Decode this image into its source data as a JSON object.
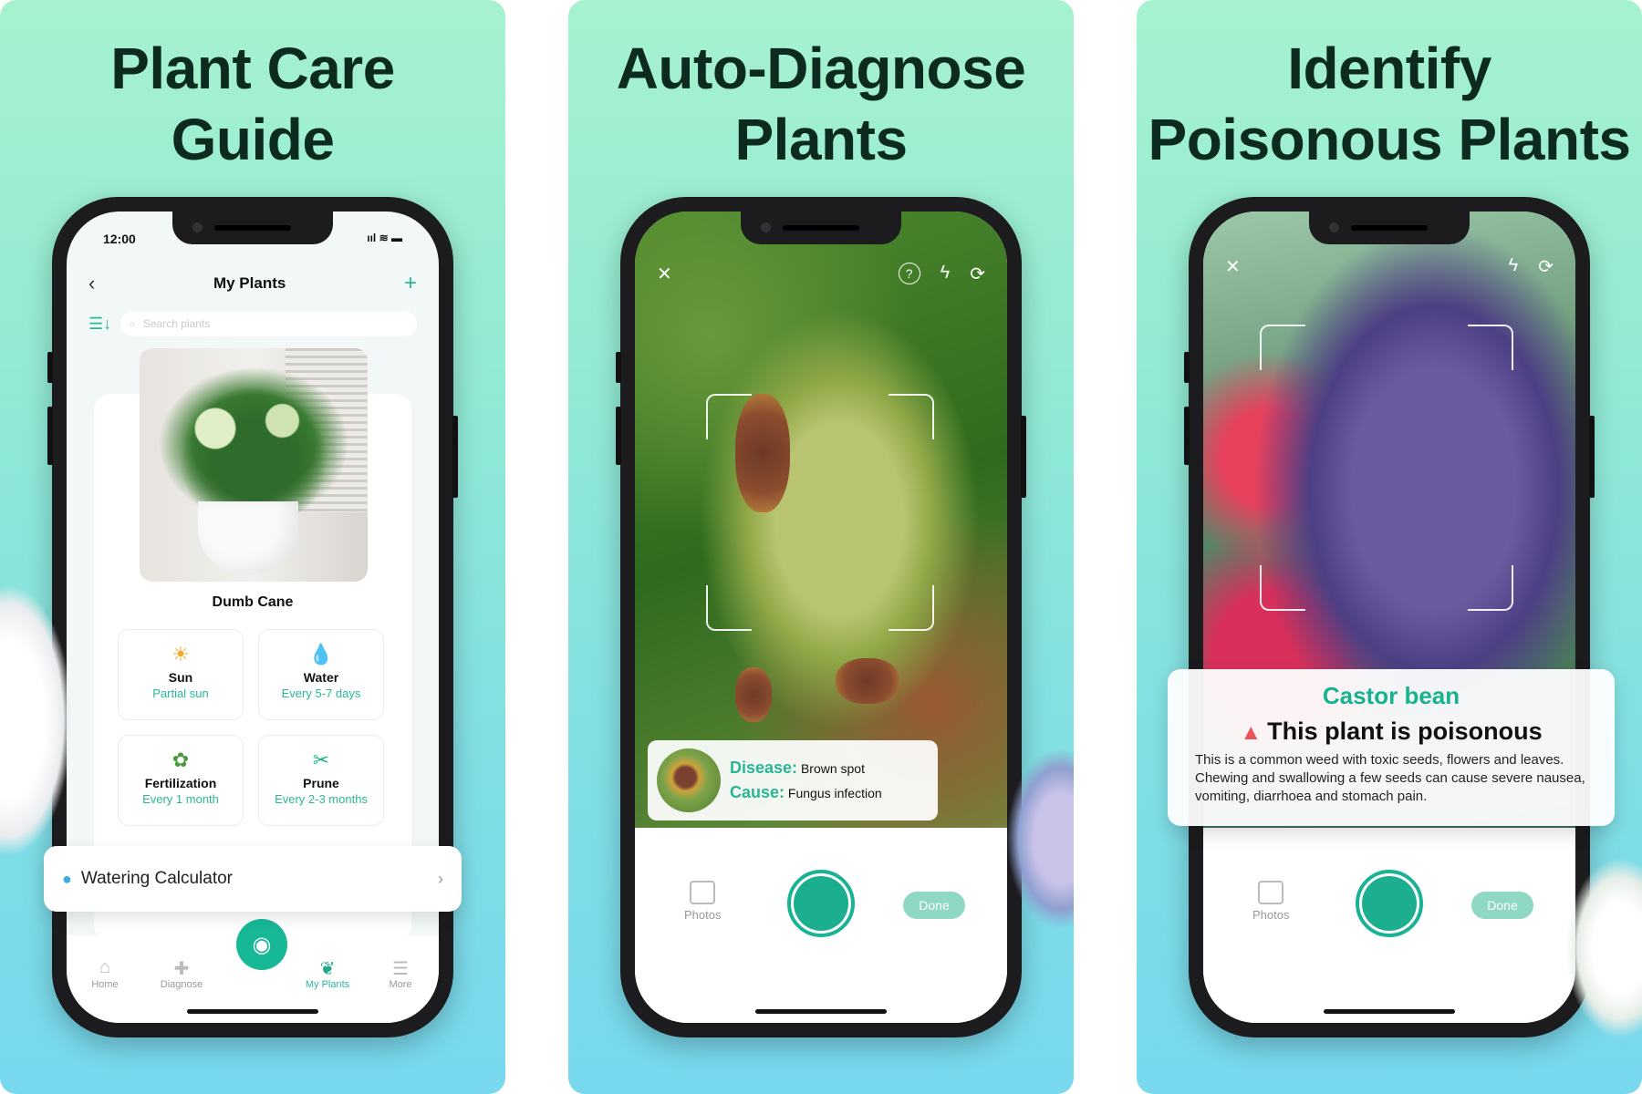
{
  "panels": [
    {
      "headline_line1": "Plant Care",
      "headline_line2": "Guide",
      "status_time": "12:00",
      "status_icons": "ııl ≋ ▬",
      "nav": {
        "back_icon": "‹",
        "title": "My Plants",
        "add_icon": "+"
      },
      "search": {
        "sort_icon": "☰↓",
        "search_icon": "⌕",
        "placeholder": "Search plants"
      },
      "plant_name": "Dumb Cane",
      "care_tiles": [
        {
          "icon": "☀",
          "icon_name": "sun-icon",
          "title": "Sun",
          "value": "Partial sun",
          "icon_color": "#f5a623"
        },
        {
          "icon": "💧",
          "icon_name": "water-drop-icon",
          "title": "Water",
          "value": "Every 5-7 days",
          "icon_color": "#3aa8e0"
        },
        {
          "icon": "✿",
          "icon_name": "fertilizer-icon",
          "title": "Fertilization",
          "value": "Every 1 month",
          "icon_color": "#4a9a3a"
        },
        {
          "icon": "✂",
          "icon_name": "scissors-icon",
          "title": "Prune",
          "value": "Every 2-3 months",
          "icon_color": "#1fb08e"
        }
      ],
      "watering_calc": {
        "icon": "●",
        "label": "Watering Calculator",
        "chevron": "›"
      },
      "tabs": [
        {
          "icon": "⌂",
          "label": "Home",
          "active": false
        },
        {
          "icon": "✚",
          "label": "Diagnose",
          "active": false
        },
        {
          "icon": "❦",
          "label": "My Plants",
          "active": true
        },
        {
          "icon": "☰",
          "label": "More",
          "active": false
        }
      ],
      "camera_fab_icon": "◉"
    },
    {
      "headline_line1": "Auto-Diagnose",
      "headline_line2": "Plants",
      "top_icons": {
        "close": "✕",
        "help": "?",
        "flash": "ϟ",
        "flip": "⟳"
      },
      "diagnosis": {
        "disease_label": "Disease:",
        "disease_value": "Brown spot",
        "cause_label": "Cause:",
        "cause_value": "Fungus infection"
      },
      "photos_label": "Photos",
      "done_label": "Done"
    },
    {
      "headline_line1": "Identify",
      "headline_line2": "Poisonous  Plants",
      "top_icons": {
        "close": "✕",
        "flash": "ϟ",
        "flip": "⟳"
      },
      "result": {
        "plant_name": "Castor bean",
        "warning_icon": "▲",
        "warning_title": "This plant is poisonous",
        "description": "This is a common weed with toxic seeds, flowers and leaves. Chewing and swallowing a few seeds can cause severe nausea, vomiting, diarrhoea and stomach pain."
      },
      "photos_label": "Photos",
      "done_label": "Done"
    }
  ],
  "colors": {
    "accent": "#1fb08e",
    "headline": "#0c2a1e",
    "warning": "#e8545a"
  }
}
